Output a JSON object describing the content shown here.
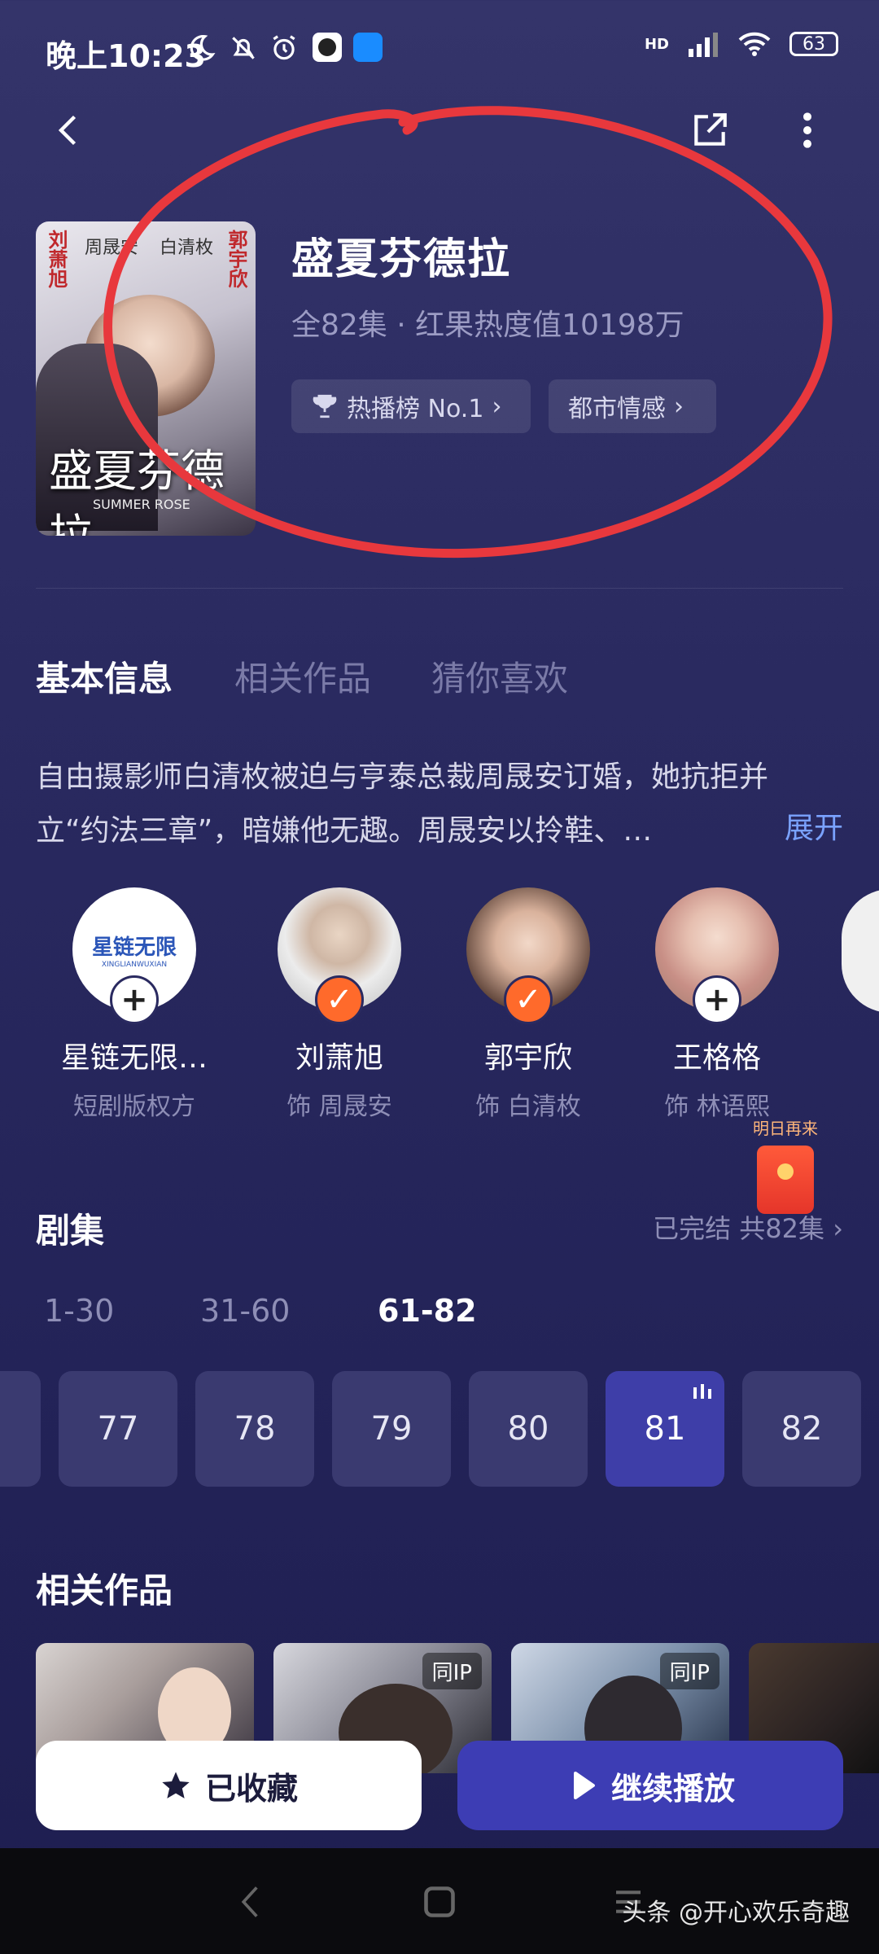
{
  "status_bar": {
    "time": "晚上10:23",
    "network": "HD",
    "battery": "63"
  },
  "header": {
    "back_icon": "back-icon",
    "share_icon": "share-icon",
    "more_icon": "more-icon"
  },
  "drama": {
    "poster_cast": [
      "刘萧旭",
      "周晟安",
      "白清枚",
      "郭宇欣"
    ],
    "poster_title": "盛夏芬德拉",
    "poster_subtitle": "SUMMER ROSE",
    "title": "盛夏芬德拉",
    "meta": "全82集 · 红果热度值10198万",
    "chips": [
      {
        "label": "热播榜 No.1",
        "icon": "trophy-icon"
      },
      {
        "label": "都市情感",
        "icon": ""
      }
    ]
  },
  "tabs": [
    "基本信息",
    "相关作品",
    "猜你喜欢"
  ],
  "description": {
    "text": "自由摄影师白清枚被迫与亨泰总裁周晟安订婚，她抗拒并立“约法三章”，暗嫌他无趣。周晟安以拎鞋、…",
    "expand": "展开"
  },
  "people": [
    {
      "name": "星链无限…",
      "role": "短剧版权方",
      "badge": "+",
      "logo": "星链无限",
      "logo_sub": "XINGLIANWUXIAN"
    },
    {
      "name": "刘萧旭",
      "role": "饰 周晟安",
      "badge": "✓"
    },
    {
      "name": "郭宇欣",
      "role": "饰 白清枚",
      "badge": "✓"
    },
    {
      "name": "王格格",
      "role": "饰 林语熙",
      "badge": "+"
    }
  ],
  "red_packet": {
    "label": "明日再来"
  },
  "episodes": {
    "title": "剧集",
    "status": "已完结 共82集",
    "ranges": [
      "1-30",
      "31-60",
      "61-82"
    ],
    "active_range": "61-82",
    "list": [
      "77",
      "78",
      "79",
      "80",
      "81",
      "82"
    ],
    "playing": "81"
  },
  "related": {
    "title": "相关作品",
    "items": [
      {
        "tag": ""
      },
      {
        "tag": "同IP"
      },
      {
        "tag": "同IP"
      },
      {
        "tag": ""
      }
    ]
  },
  "actions": {
    "favorite": "已收藏",
    "play": "继续播放"
  },
  "watermark": "头条 @开心欢乐奇趣",
  "colors": {
    "accent": "#3d3db4",
    "badge_orange": "#ff6a2b",
    "link": "#7aa2ff",
    "annotation": "#e8383d"
  }
}
